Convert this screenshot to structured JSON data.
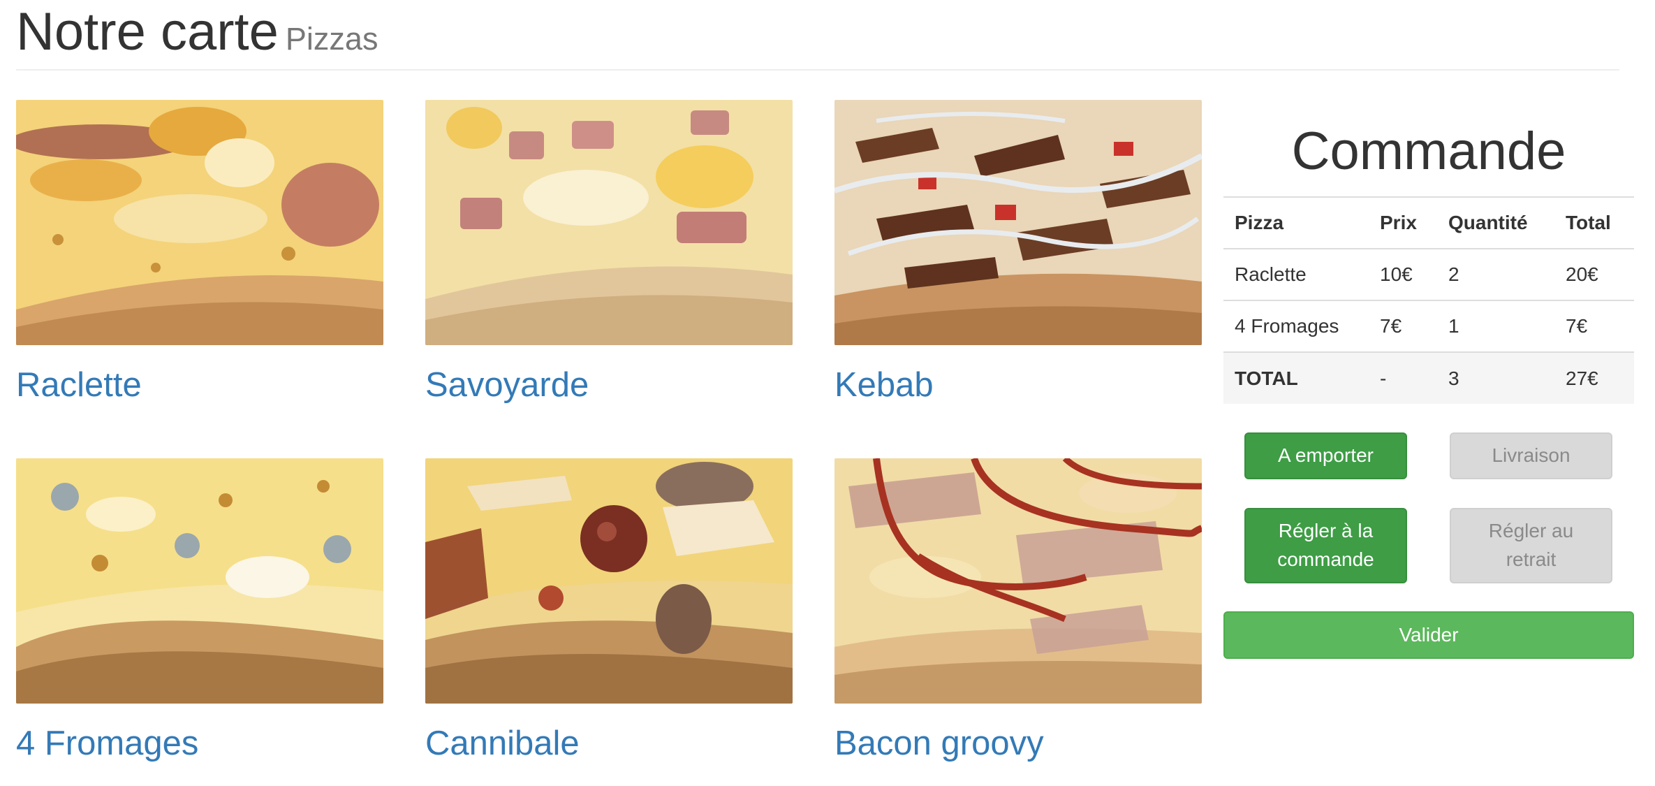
{
  "header": {
    "title": "Notre carte",
    "subtitle": "Pizzas"
  },
  "pizzas": [
    {
      "name": "Raclette"
    },
    {
      "name": "Savoyarde"
    },
    {
      "name": "Kebab"
    },
    {
      "name": "4 Fromages"
    },
    {
      "name": "Cannibale"
    },
    {
      "name": "Bacon groovy"
    }
  ],
  "order": {
    "title": "Commande",
    "columns": [
      "Pizza",
      "Prix",
      "Quantité",
      "Total"
    ],
    "rows": [
      {
        "pizza": "Raclette",
        "price": "10€",
        "quantity": "2",
        "total": "20€"
      },
      {
        "pizza": "4 Fromages",
        "price": "7€",
        "quantity": "1",
        "total": "7€"
      }
    ],
    "total": {
      "label": "TOTAL",
      "price": "-",
      "quantity": "3",
      "total": "27€"
    },
    "buttons": {
      "takeaway": "A emporter",
      "delivery": "Livraison",
      "pay_order": "Régler à la commande",
      "pay_pickup": "Régler au retrait",
      "validate": "Valider"
    },
    "selected": {
      "mode": "takeaway",
      "payment": "pay_order"
    }
  },
  "colors": {
    "link": "#337ab7",
    "selected": "#3e9d45",
    "unselected": "#d9d9d9",
    "validate": "#5cb85c"
  }
}
